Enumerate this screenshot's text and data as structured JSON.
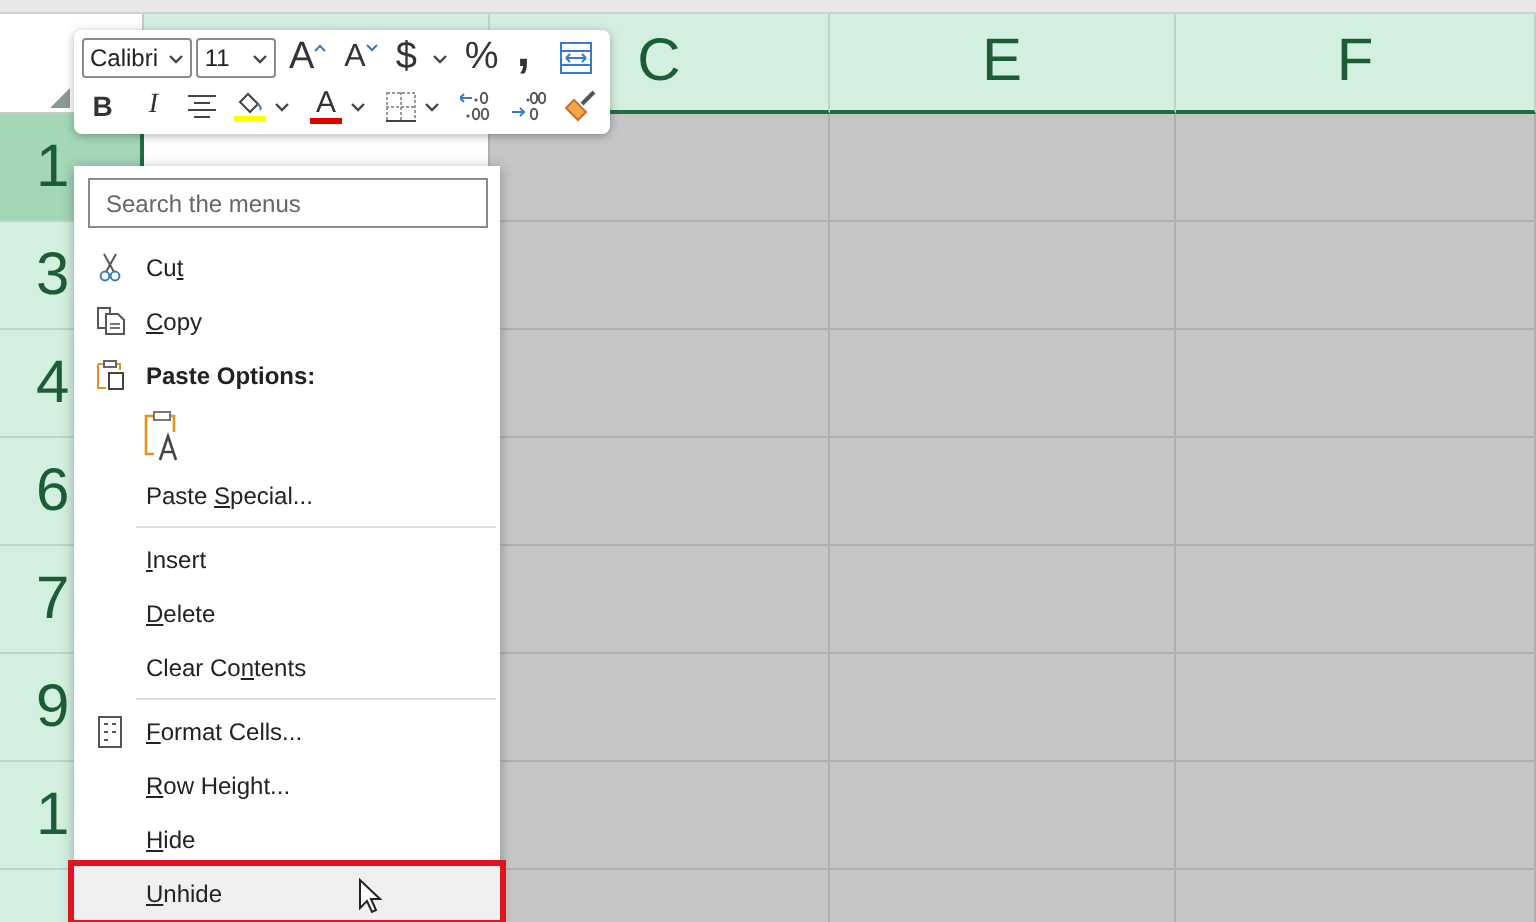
{
  "sheet": {
    "columns": [
      {},
      {
        "label": "C"
      },
      {
        "label": "E"
      },
      {
        "label": "F"
      }
    ],
    "rows": [
      {
        "label": "1",
        "selected": true
      },
      {
        "label": "3",
        "selected": false
      },
      {
        "label": "4",
        "selected": false
      },
      {
        "label": "6",
        "selected": false
      },
      {
        "label": "7",
        "selected": false
      },
      {
        "label": "9",
        "selected": false
      },
      {
        "label": "1",
        "selected": false
      },
      {
        "selected": false
      }
    ]
  },
  "mini_toolbar": {
    "font": "Calibri",
    "size": "11",
    "row_1": [
      {
        "kind": "grow-font",
        "text": "A"
      },
      {
        "kind": "shrink-font",
        "text": "A"
      },
      {
        "kind": "glyph",
        "text": "$"
      },
      {
        "kind": "caret"
      },
      {
        "kind": "glyph",
        "text": "%"
      },
      {
        "kind": "comma",
        "text": ","
      },
      {
        "kind": "wrap"
      }
    ],
    "row_2": [
      {
        "kind": "bold",
        "text": "B"
      },
      {
        "kind": "italic",
        "text": "I"
      },
      {
        "kind": "align"
      },
      {
        "kind": "fill-color",
        "color": "#ffff00"
      },
      {
        "kind": "caret"
      },
      {
        "kind": "font-color",
        "text": "A",
        "color": "#e00000"
      },
      {
        "kind": "caret"
      },
      {
        "kind": "borders"
      },
      {
        "kind": "caret"
      },
      {
        "kind": "decrease-decimal"
      },
      {
        "kind": "increase-decimal"
      },
      {
        "kind": "format-painter"
      }
    ]
  },
  "context_menu": {
    "search": {
      "placeholder": "Search the menus"
    },
    "items": [
      {
        "kind": "cut",
        "before": "Cu",
        "key": "t",
        "selected": false,
        "outlined": false
      },
      {
        "kind": "copy",
        "key": "C",
        "after": "opy",
        "selected": false,
        "outlined": false
      },
      {
        "kind": "paste-header",
        "label": "Paste Options:"
      },
      {
        "kind": "paste-option"
      },
      {
        "kind": "command",
        "before": "Paste ",
        "key": "S",
        "after": "pecial...",
        "selected": false,
        "outlined": false
      },
      {
        "kind": "separator"
      },
      {
        "kind": "command",
        "key": "I",
        "after": "nsert",
        "selected": false,
        "outlined": false
      },
      {
        "kind": "command",
        "key": "D",
        "after": "elete",
        "selected": false,
        "outlined": false
      },
      {
        "kind": "command",
        "before": "Clear Co",
        "key": "n",
        "after": "tents",
        "selected": false,
        "outlined": false
      },
      {
        "kind": "separator"
      },
      {
        "kind": "format",
        "key": "F",
        "after": "ormat Cells...",
        "selected": false,
        "outlined": false
      },
      {
        "kind": "command",
        "key": "R",
        "after": "ow Height...",
        "selected": false,
        "outlined": false
      },
      {
        "kind": "command",
        "key": "H",
        "after": "ide",
        "selected": false,
        "outlined": false
      },
      {
        "kind": "command",
        "key": "U",
        "after": "nhide",
        "selected": true,
        "outlined": true
      }
    ]
  }
}
